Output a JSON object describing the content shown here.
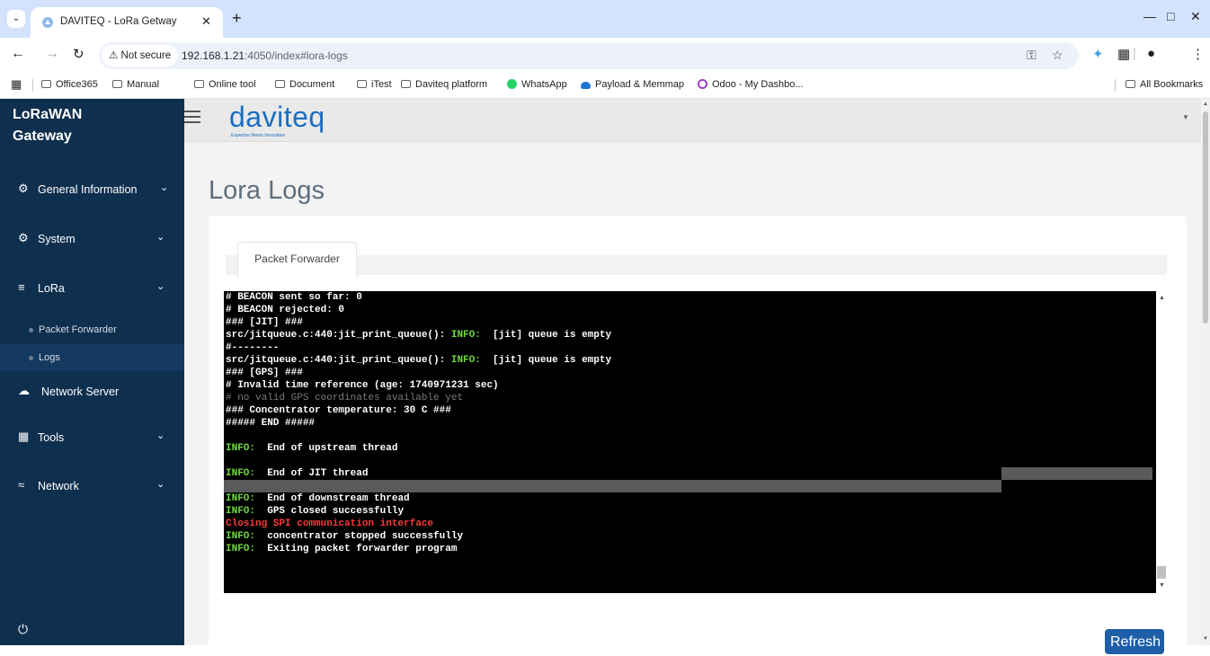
{
  "browser": {
    "tab_title": "DAVITEQ - LoRa Getway",
    "not_secure": "Not secure",
    "url_host": "192.168.1.21",
    "url_path": ":4050/index#lora-logs",
    "bookmarks": [
      "Office365",
      "Manual",
      "Online tool",
      "Document",
      "iTest",
      "Daviteq platform",
      "WhatsApp",
      "Payload & Memmap",
      "Odoo - My Dashbo..."
    ],
    "all_bookmarks": "All Bookmarks",
    "icons": {
      "back": "back-arrow-icon",
      "forward": "forward-arrow-icon",
      "reload": "reload-icon"
    }
  },
  "sidebar": {
    "brand_line1": "LoRaWAN",
    "brand_line2": "Gateway",
    "items": [
      {
        "label": "General Information",
        "icon": "gear-icon"
      },
      {
        "label": "System",
        "icon": "gear-icon"
      },
      {
        "label": "LoRa",
        "icon": "antenna-icon"
      },
      {
        "label": "Network Server",
        "icon": "cloud-icon"
      },
      {
        "label": "Tools",
        "icon": "grid-icon"
      },
      {
        "label": "Network",
        "icon": "wifi-icon"
      }
    ],
    "sub_items": [
      "Packet Forwarder",
      "Logs"
    ]
  },
  "header": {
    "logo": "daviteq",
    "logo_tagline": "Expertise Meets Innovation"
  },
  "page": {
    "title": "Lora Logs",
    "tab": "Packet Forwarder",
    "refresh_label": "Refresh"
  },
  "logs": [
    [
      {
        "t": "# BEACON sent so far: 0"
      }
    ],
    [
      {
        "t": "# BEACON rejected: 0"
      }
    ],
    [
      {
        "t": "### [JIT] ###"
      }
    ],
    [
      {
        "t": "src/jitqueue.c:440:jit_print_queue(): "
      },
      {
        "t": "INFO:",
        "c": "g"
      },
      {
        "t": "  [jit] queue is empty"
      }
    ],
    [
      {
        "t": "#--------"
      }
    ],
    [
      {
        "t": "src/jitqueue.c:440:jit_print_queue(): "
      },
      {
        "t": "INFO:",
        "c": "g"
      },
      {
        "t": "  [jit] queue is empty"
      }
    ],
    [
      {
        "t": "### [GPS] ###"
      }
    ],
    [
      {
        "t": "# Invalid time reference (age: 1740971231 sec)"
      }
    ],
    [
      {
        "t": "# no valid GPS coordinates available yet",
        "c": "gray"
      }
    ],
    [
      {
        "t": "### Concentrator temperature: 30 C ###"
      }
    ],
    [
      {
        "t": "##### END #####"
      }
    ],
    [
      {
        "t": ""
      }
    ],
    [
      {
        "t": "INFO:",
        "c": "g"
      },
      {
        "t": "  End of upstream thread"
      }
    ],
    [
      {
        "t": ""
      }
    ],
    [
      {
        "t": "INFO:",
        "c": "g"
      },
      {
        "t": "  End of JIT thread"
      }
    ],
    [
      {
        "t": ""
      }
    ],
    [
      {
        "t": "INFO:",
        "c": "g"
      },
      {
        "t": "  End of downstream thread"
      }
    ],
    [
      {
        "t": "INFO:",
        "c": "g"
      },
      {
        "t": "  GPS closed successfully"
      }
    ],
    [
      {
        "t": "Closing SPI communication interface",
        "c": "red"
      }
    ],
    [
      {
        "t": "INFO:",
        "c": "g"
      },
      {
        "t": "  concentrator stopped successfully"
      }
    ],
    [
      {
        "t": "INFO:",
        "c": "g"
      },
      {
        "t": "  Exiting packet forwarder program"
      }
    ]
  ],
  "colors": {
    "sidebar_bg": "#0f2f4f",
    "accent": "#1a6fc2",
    "info_green": "#6fdc3c",
    "error_red": "#ff3838"
  }
}
